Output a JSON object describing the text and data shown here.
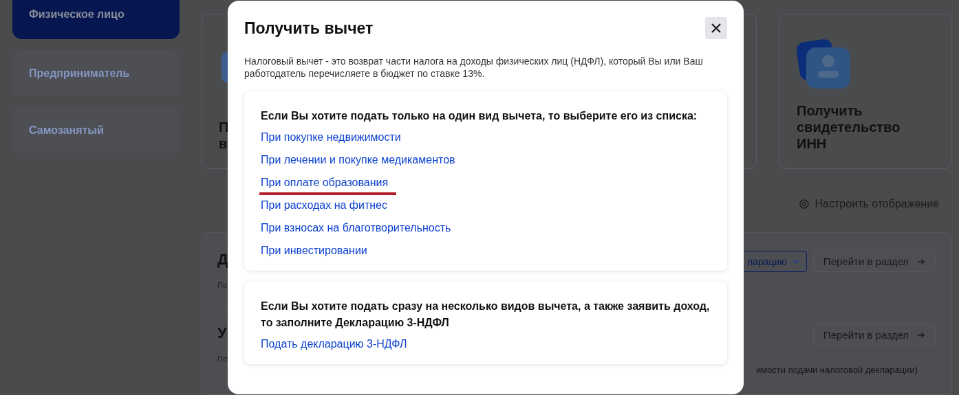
{
  "sidebar": {
    "items": [
      {
        "label": "Физическое лицо",
        "selected": true
      },
      {
        "label": "Предприниматель",
        "selected": false
      },
      {
        "label": "Самозанятый",
        "selected": false
      }
    ]
  },
  "cards": [
    {
      "title_lines": [
        "П",
        "в"
      ]
    },
    {
      "title_lines": [
        "Получить",
        "свидетельство",
        "ИНН"
      ]
    }
  ],
  "settings_link": "Настроить отображение",
  "sections": [
    {
      "title": "Д",
      "subtitle": "По",
      "dropdown": "ларацию",
      "button": "Перейти в раздел"
    },
    {
      "title": "У",
      "subtitle": "По",
      "button": "Перейти в раздел",
      "note": "имости подачи налоговой декларации)"
    }
  ],
  "modal": {
    "title": "Получить вычет",
    "description": "Налоговый вычет - это возврат части налога на доходы физических лиц (НДФЛ), который Вы или Ваш работодатель перечисляете в бюджет по ставке 13%.",
    "groups": [
      {
        "heading": "Если Вы хотите подать только на один вид вычета, то выберите его из списка:",
        "links": [
          {
            "label": "При покупке недвижимости",
            "underlined": false
          },
          {
            "label": "При лечении и покупке медикаментов",
            "underlined": false
          },
          {
            "label": "При оплате образования",
            "underlined": true
          },
          {
            "label": "При расходах на фитнес",
            "underlined": false
          },
          {
            "label": "При взносах на благотворительность",
            "underlined": false
          },
          {
            "label": "При инвестировании",
            "underlined": false
          }
        ]
      },
      {
        "heading": "Если Вы хотите подать сразу на несколько видов вычета, а также заявить доход, то заполните Декларацию 3-НДФЛ",
        "links": [
          {
            "label": "Подать декларацию 3-НДФЛ",
            "underlined": false
          }
        ]
      }
    ]
  }
}
